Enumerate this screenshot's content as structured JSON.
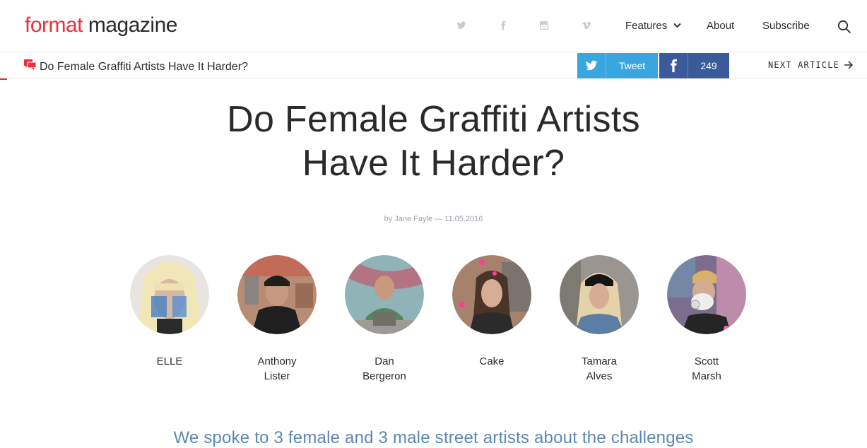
{
  "header": {
    "logo_brand": "format",
    "logo_word": " magazine",
    "social": [
      "twitter-icon",
      "facebook-icon",
      "instagram-icon",
      "vimeo-icon"
    ],
    "nav": {
      "features": "Features",
      "about": "About",
      "subscribe": "Subscribe"
    }
  },
  "article_bar": {
    "title": "Do Female Graffiti Artists Have It Harder?",
    "tweet_label": "Tweet",
    "fb_count": "249",
    "next_label": "NEXT ARTICLE"
  },
  "article": {
    "headline_line1": "Do Female Graffiti Artists",
    "headline_line2": "Have It Harder?",
    "byline": "by Jane Fayle — 11.05.2016",
    "artists": [
      {
        "line1": "ELLE",
        "line2": ""
      },
      {
        "line1": "Anthony",
        "line2": "Lister"
      },
      {
        "line1": "Dan",
        "line2": "Bergeron"
      },
      {
        "line1": "Cake",
        "line2": ""
      },
      {
        "line1": "Tamara",
        "line2": "Alves"
      },
      {
        "line1": "Scott",
        "line2": "Marsh"
      }
    ],
    "dek": "We spoke to 3 female and 3 male street artists about the challenges"
  },
  "colors": {
    "brand_red": "#e8303f",
    "twitter_blue": "#3aa6df",
    "facebook_blue": "#3b5a9a",
    "dek_blue": "#5b88b1"
  }
}
